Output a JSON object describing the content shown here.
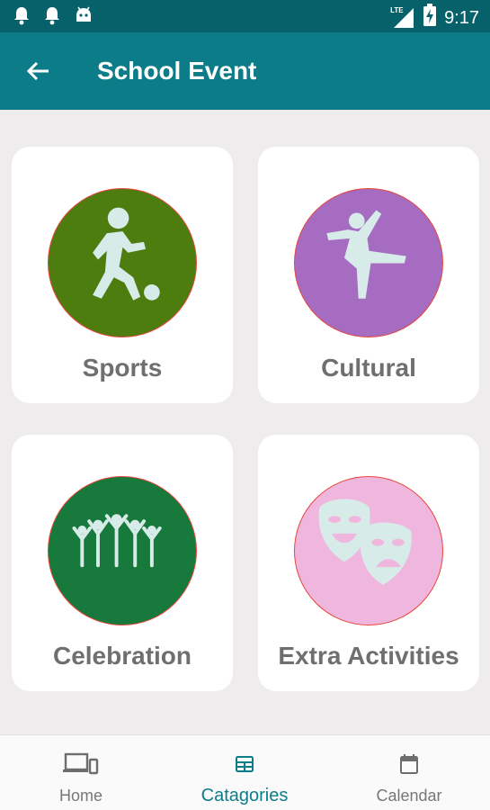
{
  "status_bar": {
    "time": "9:17",
    "network": "LTE",
    "icons": [
      "notification-bell-icon",
      "notification-bell-icon",
      "android-icon",
      "lte-signal-icon",
      "battery-charging-icon"
    ]
  },
  "app_bar": {
    "title": "School Event",
    "back_icon": "back-arrow-icon"
  },
  "categories": [
    {
      "label": "Sports",
      "icon": "soccer-player-icon",
      "color": "#4d7c0f"
    },
    {
      "label": "Cultural",
      "icon": "ballet-dancer-icon",
      "color": "#a56cc1"
    },
    {
      "label": "Celebration",
      "icon": "cheering-crowd-icon",
      "color": "#177a3c"
    },
    {
      "label": "Extra Activities",
      "icon": "theater-masks-icon",
      "color": "#f0b7de"
    }
  ],
  "bottom_nav": {
    "items": [
      {
        "label": "Home",
        "icon": "devices-icon",
        "active": false
      },
      {
        "label": "Catagories",
        "icon": "grid-table-icon",
        "active": true
      },
      {
        "label": "Calendar",
        "icon": "calendar-icon",
        "active": false
      }
    ]
  },
  "colors": {
    "status_bar": "#06616b",
    "app_bar": "#0c7d88",
    "background": "#eeecec",
    "card": "#ffffff",
    "circle_border": "#e8453c",
    "icon_fill": "#d7ebe8",
    "label_text": "#6f6f6f",
    "nav_active": "#0c7d88"
  }
}
